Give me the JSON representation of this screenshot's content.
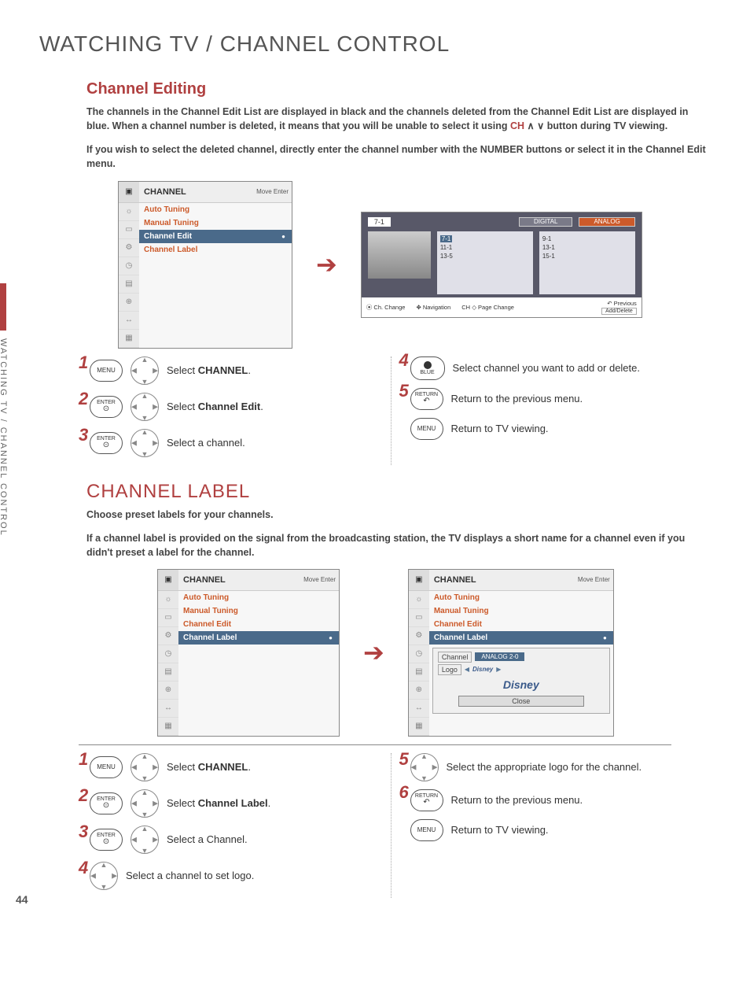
{
  "page_title": "WATCHING TV / CHANNEL CONTROL",
  "side_tab": "WATCHING TV / CHANNEL CONTROL",
  "page_number": "44",
  "channel_editing": {
    "heading": "Channel Editing",
    "intro_1": "The channels in the Channel Edit List are displayed in black and the channels deleted from the Channel Edit List are displayed in blue. When a channel number is deleted, it means that you will be unable to select it using ",
    "intro_ch": "CH",
    "intro_1b": " ∧ ∨ button during TV viewing.",
    "intro_2a": "If you wish to select the deleted channel, directly enter the channel number with the NUMBER buttons or select it in the ",
    "intro_2_bold": "Channel Edit",
    "intro_2b": " menu.",
    "osd": {
      "title": "CHANNEL",
      "hints": "Move   Enter",
      "items": [
        "Auto Tuning",
        "Manual Tuning",
        "Channel Edit",
        "Channel Label"
      ],
      "selected_index": 2
    },
    "edit_screen": {
      "current": "7-1",
      "tabs": [
        "DIGITAL",
        "ANALOG"
      ],
      "digital_channels": [
        "7-1",
        "11-1",
        "13-5"
      ],
      "analog_channels": [
        "9-1",
        "13-1",
        "15-1"
      ],
      "hints": {
        "ch_change": "Ch. Change",
        "nav": "Navigation",
        "page_change": "Page Change",
        "page_key": "CH",
        "previous": "Previous",
        "add_delete": "Add/Delete"
      }
    },
    "steps_left": [
      {
        "n": "1",
        "btn": "MENU",
        "dpad": true,
        "text_pre": "Select ",
        "bold": "CHANNEL",
        "text_post": "."
      },
      {
        "n": "2",
        "btn": "ENTER",
        "dpad": true,
        "text_pre": "Select ",
        "bold": "Channel Edit",
        "text_post": "."
      },
      {
        "n": "3",
        "btn": "ENTER",
        "dpad": true,
        "text_pre": "Select a channel.",
        "bold": "",
        "text_post": ""
      }
    ],
    "steps_right": [
      {
        "n": "4",
        "btn": "BLUE",
        "dpad": false,
        "text_pre": "Select channel you want to add or delete.",
        "bold": "",
        "text_post": ""
      },
      {
        "n": "5",
        "btn": "RETURN",
        "dpad": false,
        "text_pre": "Return to the previous menu.",
        "bold": "",
        "text_post": ""
      },
      {
        "n": "",
        "btn": "MENU",
        "dpad": false,
        "text_pre": "Return to TV viewing.",
        "bold": "",
        "text_post": ""
      }
    ]
  },
  "channel_label": {
    "heading": "CHANNEL LABEL",
    "intro_1": "Choose preset labels for your channels.",
    "intro_2": "If a channel label is provided on the signal from the broadcasting station, the TV displays a short name for a channel even if you didn't preset a label for the channel.",
    "osd_left": {
      "title": "CHANNEL",
      "hints": "Move   Enter",
      "items": [
        "Auto Tuning",
        "Manual Tuning",
        "Channel Edit",
        "Channel Label"
      ],
      "selected_index": 3
    },
    "osd_right": {
      "title": "CHANNEL",
      "hints": "Move   Enter",
      "items": [
        "Auto Tuning",
        "Manual Tuning",
        "Channel Edit",
        "Channel Label"
      ],
      "selected_index": 3,
      "detail": {
        "channel_key": "Channel",
        "channel_val": "ANALOG 2-0",
        "logo_key": "Logo",
        "logo_val": "Disney",
        "close": "Close"
      }
    },
    "steps_left": [
      {
        "n": "1",
        "btn": "MENU",
        "dpad": true,
        "text_pre": "Select ",
        "bold": "CHANNEL",
        "text_post": "."
      },
      {
        "n": "2",
        "btn": "ENTER",
        "dpad": true,
        "text_pre": "Select ",
        "bold": "Channel Label",
        "text_post": "."
      },
      {
        "n": "3",
        "btn": "ENTER",
        "dpad": true,
        "text_pre": "Select a Channel.",
        "bold": "",
        "text_post": ""
      },
      {
        "n": "4",
        "btn": "",
        "dpad": true,
        "text_pre": "Select a channel to set logo.",
        "bold": "",
        "text_post": ""
      }
    ],
    "steps_right": [
      {
        "n": "5",
        "btn": "",
        "dpad": true,
        "text_pre": "Select the appropriate logo for the channel.",
        "bold": "",
        "text_post": ""
      },
      {
        "n": "6",
        "btn": "RETURN",
        "dpad": false,
        "text_pre": "Return to the previous menu.",
        "bold": "",
        "text_post": ""
      },
      {
        "n": "",
        "btn": "MENU",
        "dpad": false,
        "text_pre": "Return to TV viewing.",
        "bold": "",
        "text_post": ""
      }
    ]
  }
}
